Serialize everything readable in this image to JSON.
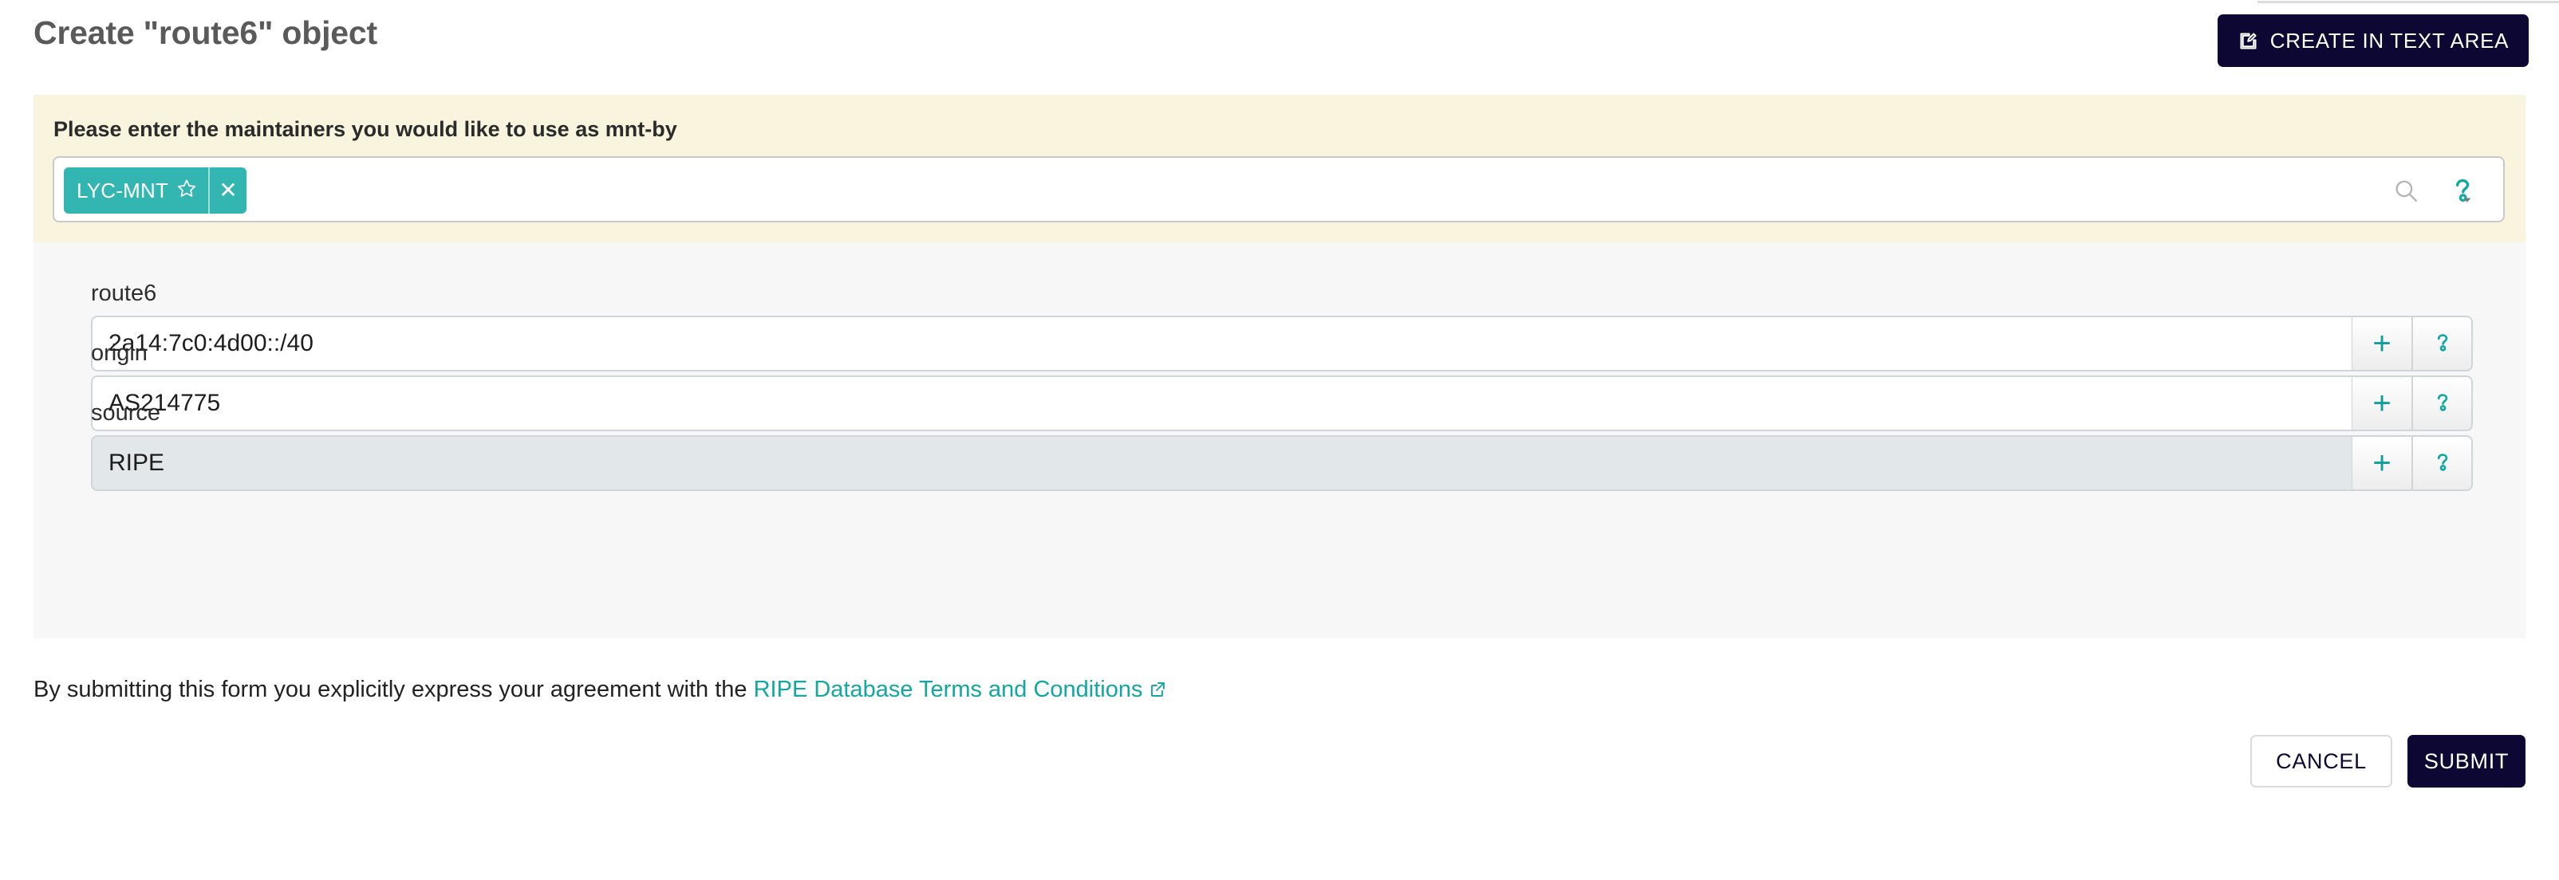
{
  "header": {
    "title": "Create \"route6\" object",
    "create_in_text_area_label": "CREATE IN TEXT AREA",
    "create_in_text_area_icon": "edit-pencil-square-icon"
  },
  "maintainers": {
    "banner_label": "Please enter the maintainers you would like to use as mnt-by",
    "search_icon": "search-icon",
    "help_icon": "question-mark-help-icon",
    "chips": [
      {
        "label": "LYC-MNT",
        "star_icon": "star-outline-icon",
        "close_icon": "close-x-icon"
      }
    ],
    "input_placeholder": ""
  },
  "attributes": [
    {
      "label": "route6",
      "value": "2a14:7c0:4d00::/40",
      "placeholder": "",
      "disabled": false,
      "add_icon": "plus-icon",
      "help_icon": "question-mark-help-icon"
    },
    {
      "label": "origin",
      "value": "AS214775",
      "placeholder": "",
      "disabled": false,
      "add_icon": "plus-icon",
      "help_icon": "question-mark-help-icon"
    },
    {
      "label": "source",
      "value": "RIPE",
      "placeholder": "",
      "disabled": true,
      "add_icon": "plus-icon",
      "help_icon": "question-mark-help-icon"
    }
  ],
  "terms": {
    "prefix": "By submitting this form you explicitly express your agreement with the ",
    "link_text": "RIPE Database Terms and Conditions",
    "external_link_icon": "external-link-icon"
  },
  "footer": {
    "cancel_label": "CANCEL",
    "submit_label": "SUBMIT"
  },
  "colors": {
    "accent_teal": "#13a7a2",
    "chip_teal": "#33b5b2",
    "dark_navy": "#0d0833",
    "banner_cream": "#f8f4dd",
    "panel_gray": "#f7f7f8",
    "disabled_field": "#e2e7ea"
  }
}
